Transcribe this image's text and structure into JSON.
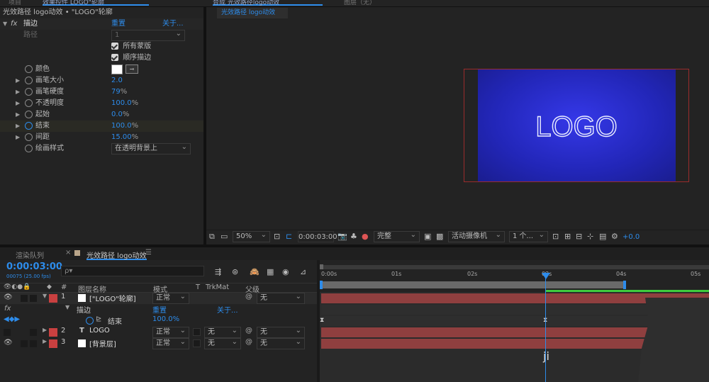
{
  "top_tabs": {
    "left_clipped": "项目",
    "effect_controls_clipped": "效果控件 LOGO\"轮廓",
    "comp_tab_clipped": "合成 光效路径logo动效",
    "layer_tab_clipped": "图层（无）"
  },
  "effect_panel": {
    "breadcrumb": "光效路径 logo动效 • \"LOGO\"轮廓",
    "effect_name": "描边",
    "reset": "重置",
    "about": "关于...",
    "path_label": "路径",
    "path_value": "1",
    "cb_all_masks": "所有蒙版",
    "cb_sequential": "顺序描边",
    "props": [
      {
        "label": "颜色",
        "value": ""
      },
      {
        "label": "画笔大小",
        "value": "2.0"
      },
      {
        "label": "画笔硬度",
        "value": "79",
        "unit": "%"
      },
      {
        "label": "不透明度",
        "value": "100.0",
        "unit": "%"
      },
      {
        "label": "起始",
        "value": "0.0",
        "unit": "%"
      },
      {
        "label": "结束",
        "value": "100.0",
        "unit": "%"
      },
      {
        "label": "间距",
        "value": "15.00",
        "unit": "%"
      },
      {
        "label": "绘画样式",
        "value": "在透明背景上"
      }
    ],
    "color_hex": "#ffffff"
  },
  "comp": {
    "tab": "光效路径 logo动效",
    "logo_text": "LOGO",
    "zoom": "50%",
    "timecode": "0:00:03:00",
    "quality": "完整",
    "camera": "活动摄像机",
    "views": "1 个...",
    "exposure": "+0.0",
    "bg_color": "#2b2fd6"
  },
  "timeline": {
    "tab_render": "渲染队列",
    "tab_comp": "光效路径 logo动效",
    "timecode": "0:00:03:00",
    "fps": "00075 (25.00 fps)",
    "search_placeholder": "ρ▾",
    "col_name": "图层名称",
    "col_mode": "模式",
    "col_t": "T",
    "col_trkmat": "TrkMat",
    "col_parent": "父级",
    "ruler": [
      "0:00s",
      "01s",
      "02s",
      "03s",
      "04s",
      "05s"
    ],
    "layers": [
      {
        "num": "1",
        "name": "[\"LOGO\"轮廓]",
        "mode": "正常",
        "trkmat": "",
        "parent": "无",
        "color": "#c94040"
      },
      {
        "num": "2",
        "name": "LOGO",
        "mode": "正常",
        "trkmat": "无",
        "parent": "无",
        "color": "#c94040"
      },
      {
        "num": "3",
        "name": "[背景层]",
        "mode": "正常",
        "trkmat": "无",
        "parent": "无",
        "color": "#c94040"
      }
    ],
    "fx_row": {
      "name": "描边",
      "reset": "重置",
      "about": "关于..."
    },
    "end_row": {
      "name": "结束",
      "value": "100.0%"
    },
    "cursor_text": "ji"
  }
}
